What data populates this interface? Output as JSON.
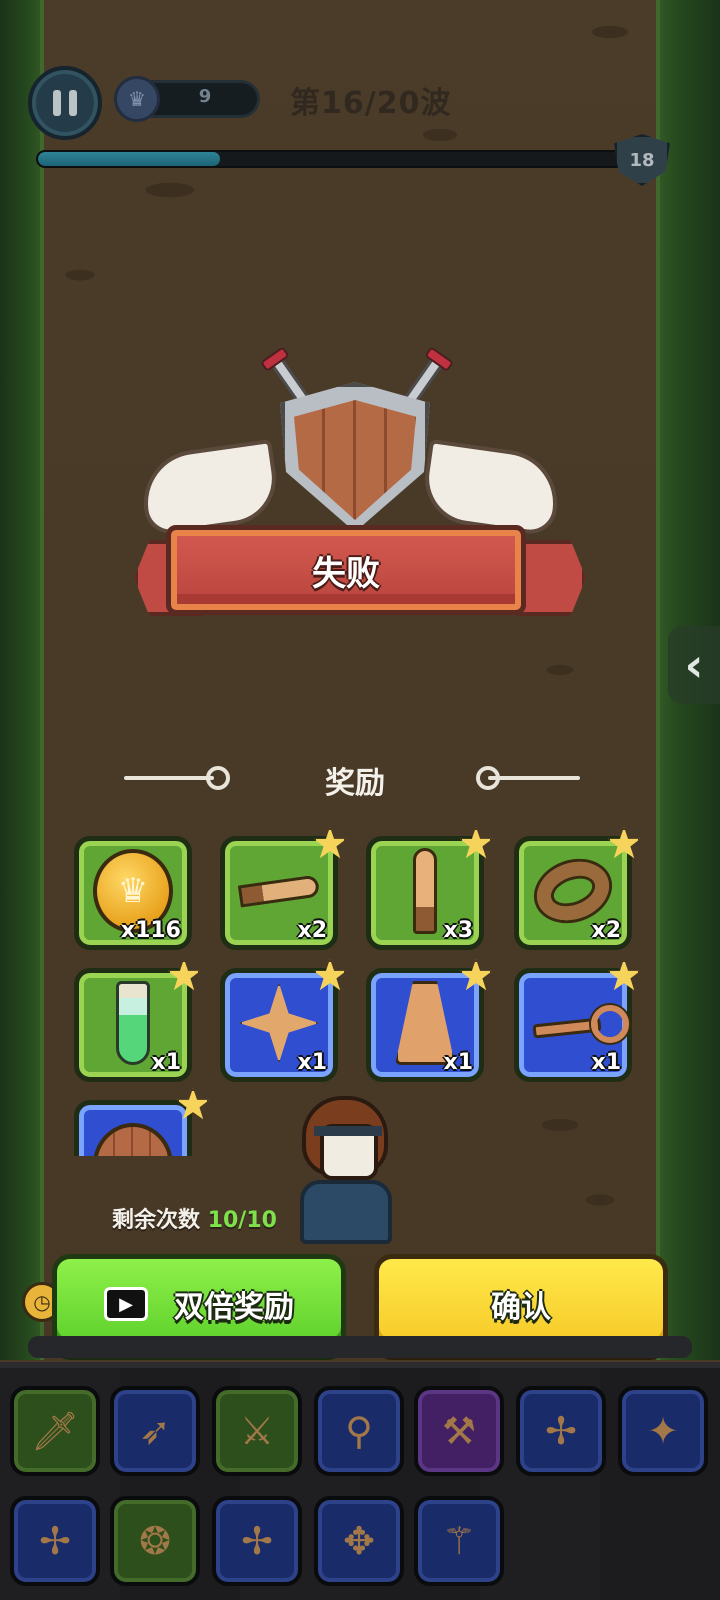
{
  "hud": {
    "player_level": "9",
    "wave_label": "第16/20波",
    "wave_progress": 0.31,
    "wave_badge": "18"
  },
  "result": {
    "title": "失败"
  },
  "rewards": {
    "header": "奖励",
    "items": [
      {
        "name": "gold-coin",
        "qty": "x116",
        "rarity": "green",
        "has_star": false
      },
      {
        "name": "dagger",
        "qty": "x2",
        "rarity": "green",
        "has_star": true
      },
      {
        "name": "short-sword",
        "qty": "x3",
        "rarity": "green",
        "has_star": true
      },
      {
        "name": "ring",
        "qty": "x2",
        "rarity": "green",
        "has_star": true
      },
      {
        "name": "potion-vial",
        "qty": "x1",
        "rarity": "green",
        "has_star": true
      },
      {
        "name": "shuriken",
        "qty": "x1",
        "rarity": "blue",
        "has_star": true
      },
      {
        "name": "cloak",
        "qty": "x1",
        "rarity": "blue",
        "has_star": true
      },
      {
        "name": "hook",
        "qty": "x1",
        "rarity": "blue",
        "has_star": true
      },
      {
        "name": "round-shield",
        "qty": "",
        "rarity": "blue",
        "has_star": true
      }
    ]
  },
  "remaining": {
    "label": "剩余次数",
    "count": "10/10"
  },
  "buttons": {
    "double_reward": "双倍奖励",
    "confirm": "确认"
  },
  "inventory": {
    "row1": [
      {
        "icon": "knife-icon",
        "rarity": "green"
      },
      {
        "icon": "spear-icon",
        "rarity": "blue"
      },
      {
        "icon": "sword-icon",
        "rarity": "green"
      },
      {
        "icon": "torch-icon",
        "rarity": "blue"
      },
      {
        "icon": "scythe-icon",
        "rarity": "purple"
      },
      {
        "icon": "crossbow-icon",
        "rarity": "blue"
      },
      {
        "icon": "shuriken-icon",
        "rarity": "blue"
      }
    ],
    "row2": [
      {
        "icon": "crossbow-icon",
        "rarity": "blue"
      },
      {
        "icon": "amulet-icon",
        "rarity": "green"
      },
      {
        "icon": "crossbow-icon",
        "rarity": "blue"
      },
      {
        "icon": "cross-star-icon",
        "rarity": "blue"
      },
      {
        "icon": "staff-icon",
        "rarity": "blue"
      }
    ]
  },
  "colors": {
    "accent_green": "#5ccf2a",
    "accent_yellow": "#f5c826",
    "remaining_green": "#7ee04a",
    "defeat_red": "#c04b44"
  }
}
